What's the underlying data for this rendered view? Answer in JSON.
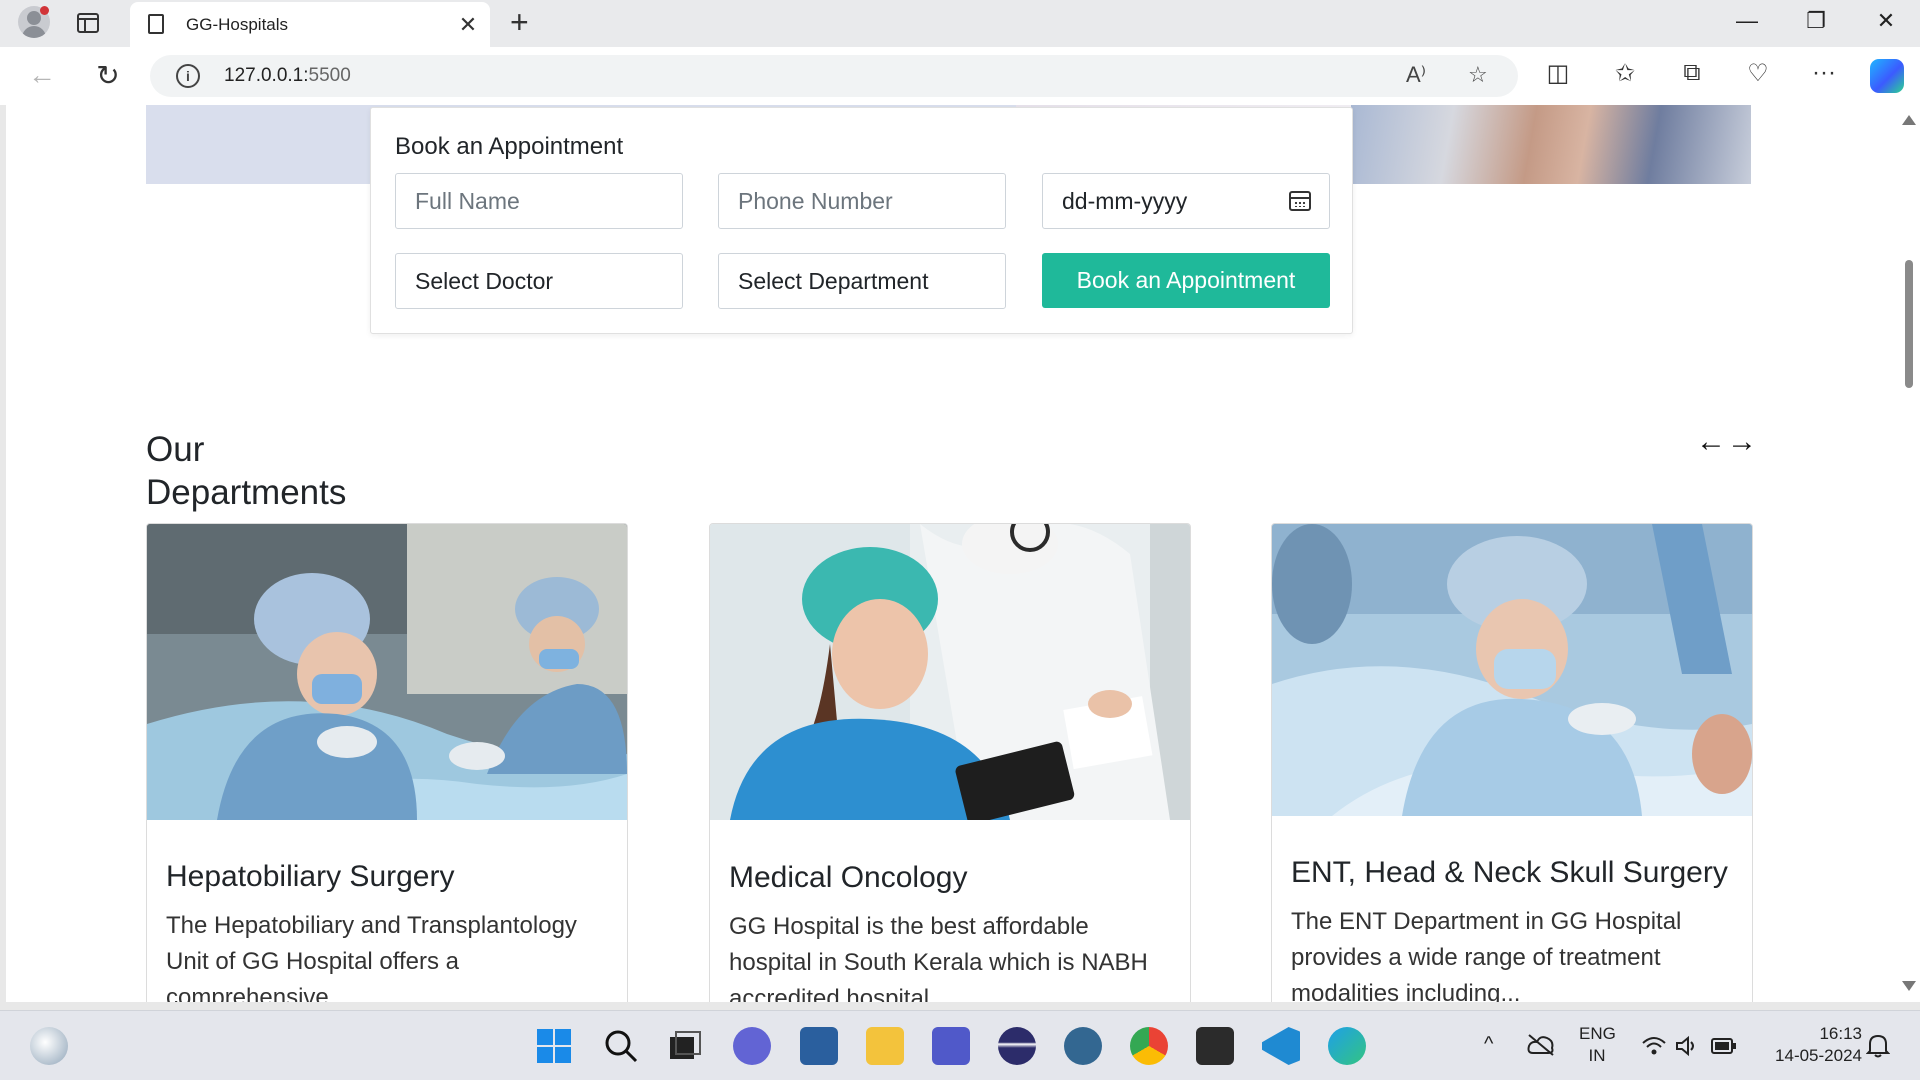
{
  "browser": {
    "tab_title": "GG-Hospitals",
    "tab_close": "✕",
    "new_tab": "+",
    "url_host": "127.0.0.1:",
    "url_port": "5500",
    "window_controls": {
      "minimize": "—",
      "restore": "❐",
      "close": "✕"
    },
    "nav": {
      "back": "←",
      "refresh": "↻"
    },
    "icons": {
      "read_aloud": "A⁾",
      "favorite": "☆",
      "split": "◫",
      "favorites": "✩",
      "collections": "⧉",
      "health": "♡",
      "more": "···"
    }
  },
  "appointment": {
    "heading": "Book an Appointment",
    "full_name_placeholder": "Full Name",
    "phone_placeholder": "Phone Number",
    "date_placeholder": "dd-mm-yyyy",
    "doctor_select": "Select Doctor",
    "department_select": "Select Department",
    "submit_label": "Book an Appointment"
  },
  "departments": {
    "title_line1": "Our",
    "title_line2": "Departments",
    "prev_arrow": "←",
    "next_arrow": "→",
    "cards": [
      {
        "title": "Hepatobiliary Surgery",
        "text": "The Hepatobiliary and Transplantology Unit of GG Hospital offers a comprehensive"
      },
      {
        "title": "Medical Oncology",
        "text": "GG Hospital is the best affordable hospital in South Kerala which is NABH accredited hospital"
      },
      {
        "title": "ENT, Head & Neck Skull Surgery",
        "text": "The ENT Department in GG Hospital provides a wide range of treatment modalities including..."
      }
    ]
  },
  "taskbar": {
    "lang_line1": "ENG",
    "lang_line2": "IN",
    "time": "16:13",
    "date": "14-05-2024",
    "tray_up": "^"
  },
  "colors": {
    "accent_button": "#1fb99a",
    "hero_left": "#d9deed"
  }
}
